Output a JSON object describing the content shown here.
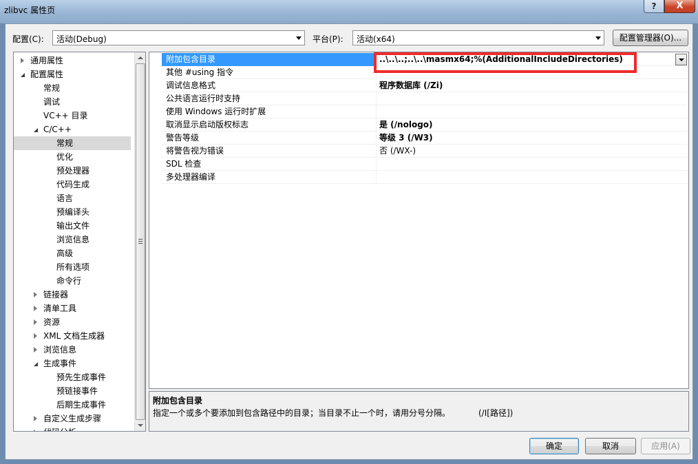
{
  "window": {
    "title": "zlibvc 属性页",
    "help_label": "?",
    "close_label": "X"
  },
  "toolbar": {
    "config_label": "配置(C):",
    "config_value": "活动(Debug)",
    "platform_label": "平台(P):",
    "platform_value": "活动(x64)",
    "config_manager_label": "配置管理器(O)..."
  },
  "tree": {
    "items": [
      {
        "label": "通用属性",
        "level": 0,
        "expander": "closed"
      },
      {
        "label": "配置属性",
        "level": 0,
        "expander": "open"
      },
      {
        "label": "常规",
        "level": 1,
        "expander": "none"
      },
      {
        "label": "调试",
        "level": 1,
        "expander": "none"
      },
      {
        "label": "VC++ 目录",
        "level": 1,
        "expander": "none"
      },
      {
        "label": "C/C++",
        "level": 1,
        "expander": "open"
      },
      {
        "label": "常规",
        "level": 2,
        "expander": "none",
        "selected": true
      },
      {
        "label": "优化",
        "level": 2,
        "expander": "none"
      },
      {
        "label": "预处理器",
        "level": 2,
        "expander": "none"
      },
      {
        "label": "代码生成",
        "level": 2,
        "expander": "none"
      },
      {
        "label": "语言",
        "level": 2,
        "expander": "none"
      },
      {
        "label": "预编译头",
        "level": 2,
        "expander": "none"
      },
      {
        "label": "输出文件",
        "level": 2,
        "expander": "none"
      },
      {
        "label": "浏览信息",
        "level": 2,
        "expander": "none"
      },
      {
        "label": "高级",
        "level": 2,
        "expander": "none"
      },
      {
        "label": "所有选项",
        "level": 2,
        "expander": "none"
      },
      {
        "label": "命令行",
        "level": 2,
        "expander": "none"
      },
      {
        "label": "链接器",
        "level": 1,
        "expander": "closed"
      },
      {
        "label": "清单工具",
        "level": 1,
        "expander": "closed"
      },
      {
        "label": "资源",
        "level": 1,
        "expander": "closed"
      },
      {
        "label": "XML 文档生成器",
        "level": 1,
        "expander": "closed"
      },
      {
        "label": "浏览信息",
        "level": 1,
        "expander": "closed"
      },
      {
        "label": "生成事件",
        "level": 1,
        "expander": "open"
      },
      {
        "label": "预先生成事件",
        "level": 2,
        "expander": "none"
      },
      {
        "label": "预链接事件",
        "level": 2,
        "expander": "none"
      },
      {
        "label": "后期生成事件",
        "level": 2,
        "expander": "none"
      },
      {
        "label": "自定义生成步骤",
        "level": 1,
        "expander": "closed"
      },
      {
        "label": "代码分析",
        "level": 1,
        "expander": "closed"
      }
    ]
  },
  "properties": [
    {
      "name": "附加包含目录",
      "value": "..\\..\\..;..\\..\\masmx64;%(AdditionalIncludeDirectories)",
      "bold": true,
      "selected": true
    },
    {
      "name": "其他 #using 指令",
      "value": "",
      "bold": false
    },
    {
      "name": "调试信息格式",
      "value": "程序数据库 (/Zi)",
      "bold": true
    },
    {
      "name": "公共语言运行时支持",
      "value": "",
      "bold": false
    },
    {
      "name": "使用 Windows 运行时扩展",
      "value": "",
      "bold": false
    },
    {
      "name": "取消显示启动版权标志",
      "value": "是 (/nologo)",
      "bold": true
    },
    {
      "name": "警告等级",
      "value": "等级 3 (/W3)",
      "bold": true
    },
    {
      "name": "将警告视为错误",
      "value": "否 (/WX-)",
      "bold": false
    },
    {
      "name": "SDL 检查",
      "value": "",
      "bold": false
    },
    {
      "name": "多处理器编译",
      "value": "",
      "bold": false
    }
  ],
  "description": {
    "title": "附加包含目录",
    "text": "指定一个或多个要添加到包含路径中的目录；当目录不止一个时，请用分号分隔。",
    "switch": "(/I[路径])"
  },
  "buttons": {
    "ok": "确定",
    "cancel": "取消",
    "apply": "应用(A)"
  }
}
